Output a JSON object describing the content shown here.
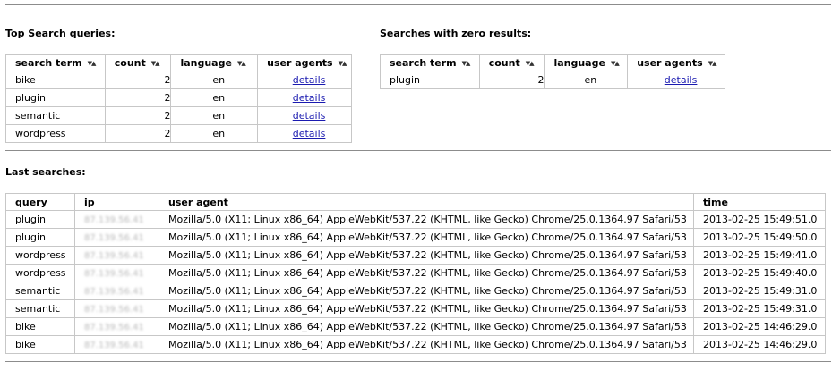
{
  "top": {
    "title": "Top Search queries:",
    "columns": [
      "search term",
      "count",
      "language",
      "user agents"
    ],
    "rows": [
      {
        "term": "bike",
        "count": "2",
        "lang": "en",
        "ua": "details"
      },
      {
        "term": "plugin",
        "count": "2",
        "lang": "en",
        "ua": "details"
      },
      {
        "term": "semantic",
        "count": "2",
        "lang": "en",
        "ua": "details"
      },
      {
        "term": "wordpress",
        "count": "2",
        "lang": "en",
        "ua": "details"
      }
    ]
  },
  "zero": {
    "title": "Searches with zero results:",
    "columns": [
      "search term",
      "count",
      "language",
      "user agents"
    ],
    "rows": [
      {
        "term": "plugin",
        "count": "2",
        "lang": "en",
        "ua": "details"
      }
    ]
  },
  "last": {
    "title": "Last searches:",
    "columns": [
      "query",
      "ip",
      "user agent",
      "time"
    ],
    "rows": [
      {
        "query": "plugin",
        "ip": "87.139.56.41",
        "ua": "Mozilla/5.0 (X11; Linux x86_64) AppleWebKit/537.22 (KHTML, like Gecko) Chrome/25.0.1364.97 Safari/53",
        "time": "2013-02-25 15:49:51.0"
      },
      {
        "query": "plugin",
        "ip": "87.139.56.41",
        "ua": "Mozilla/5.0 (X11; Linux x86_64) AppleWebKit/537.22 (KHTML, like Gecko) Chrome/25.0.1364.97 Safari/53",
        "time": "2013-02-25 15:49:50.0"
      },
      {
        "query": "wordpress",
        "ip": "87.139.56.41",
        "ua": "Mozilla/5.0 (X11; Linux x86_64) AppleWebKit/537.22 (KHTML, like Gecko) Chrome/25.0.1364.97 Safari/53",
        "time": "2013-02-25 15:49:41.0"
      },
      {
        "query": "wordpress",
        "ip": "87.139.56.41",
        "ua": "Mozilla/5.0 (X11; Linux x86_64) AppleWebKit/537.22 (KHTML, like Gecko) Chrome/25.0.1364.97 Safari/53",
        "time": "2013-02-25 15:49:40.0"
      },
      {
        "query": "semantic",
        "ip": "87.139.56.41",
        "ua": "Mozilla/5.0 (X11; Linux x86_64) AppleWebKit/537.22 (KHTML, like Gecko) Chrome/25.0.1364.97 Safari/53",
        "time": "2013-02-25 15:49:31.0"
      },
      {
        "query": "semantic",
        "ip": "87.139.56.41",
        "ua": "Mozilla/5.0 (X11; Linux x86_64) AppleWebKit/537.22 (KHTML, like Gecko) Chrome/25.0.1364.97 Safari/53",
        "time": "2013-02-25 15:49:31.0"
      },
      {
        "query": "bike",
        "ip": "87.139.56.41",
        "ua": "Mozilla/5.0 (X11; Linux x86_64) AppleWebKit/537.22 (KHTML, like Gecko) Chrome/25.0.1364.97 Safari/53",
        "time": "2013-02-25 14:46:29.0"
      },
      {
        "query": "bike",
        "ip": "87.139.56.41",
        "ua": "Mozilla/5.0 (X11; Linux x86_64) AppleWebKit/537.22 (KHTML, like Gecko) Chrome/25.0.1364.97 Safari/53",
        "time": "2013-02-25 14:46:29.0"
      }
    ]
  },
  "icons": {
    "sort": "sort-arrows-icon"
  }
}
